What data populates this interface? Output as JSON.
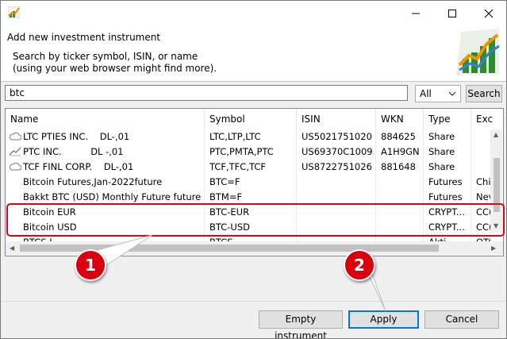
{
  "window": {
    "title": "",
    "app_icon": "portfolio-chart-icon",
    "controls": [
      "minimize-icon",
      "maximize-icon",
      "close-icon"
    ]
  },
  "header": {
    "title": "Add new investment instrument",
    "subtitle_line1": "Search by ticker symbol, ISIN, or name",
    "subtitle_line2": "(using your web browser might find more).",
    "logo": "growth-chart-logo"
  },
  "search": {
    "value": "btc",
    "placeholder": ""
  },
  "filter": {
    "selected": "All"
  },
  "search_button": "Search",
  "table": {
    "columns": [
      "Name",
      "Symbol",
      "ISIN",
      "WKN",
      "Type",
      "Exc"
    ],
    "rows": [
      {
        "icon": "cloud-icon",
        "name": "LTC PTIES INC.    DL-,01",
        "symbol": "LTC,LTP,LTC",
        "isin": "US5021751020",
        "wkn": "884625",
        "type": "Share",
        "exchange": ""
      },
      {
        "icon": "chart-line-icon",
        "name": "PTC INC.          DL -,01",
        "symbol": "PTC,PMTA,PTC",
        "isin": "US69370C1009",
        "wkn": "A1H9GN",
        "type": "Share",
        "exchange": ""
      },
      {
        "icon": "cloud-icon",
        "name": "TCF FINL CORP.    DL-,01",
        "symbol": "TCF,TFC,TCF",
        "isin": "US8722751026",
        "wkn": "881648",
        "type": "Share",
        "exchange": ""
      },
      {
        "icon": "",
        "name": "Bitcoin Futures,Jan-2022future",
        "symbol": "BTC=F",
        "isin": "",
        "wkn": "",
        "type": "Futures",
        "exchange": "Chi"
      },
      {
        "icon": "",
        "name": "Bakkt BTC (USD) Monthly Future future",
        "symbol": "BTM=F",
        "isin": "",
        "wkn": "",
        "type": "Futures",
        "exchange": "Nev"
      },
      {
        "icon": "",
        "name": "Bitcoin EUR",
        "symbol": "BTC-EUR",
        "isin": "",
        "wkn": "",
        "type": "CRYPT...",
        "exchange": "CC("
      },
      {
        "icon": "",
        "name": "Bitcoin USD",
        "symbol": "BTC-USD",
        "isin": "",
        "wkn": "",
        "type": "CRYPT...",
        "exchange": "CC("
      },
      {
        "icon": "",
        "name": "BTCS I",
        "symbol": "BTCS",
        "isin": "",
        "wkn": "",
        "type": "Akti",
        "exchange": "OTC"
      }
    ]
  },
  "annotations": {
    "badge1": "1",
    "badge2": "2"
  },
  "buttons": {
    "empty_instrument": "Empty instrument",
    "apply": "Apply",
    "cancel": "Cancel"
  },
  "colors": {
    "highlight_red": "#e0001b",
    "badge_red": "#d8000f",
    "default_button_border": "#0078d7"
  }
}
